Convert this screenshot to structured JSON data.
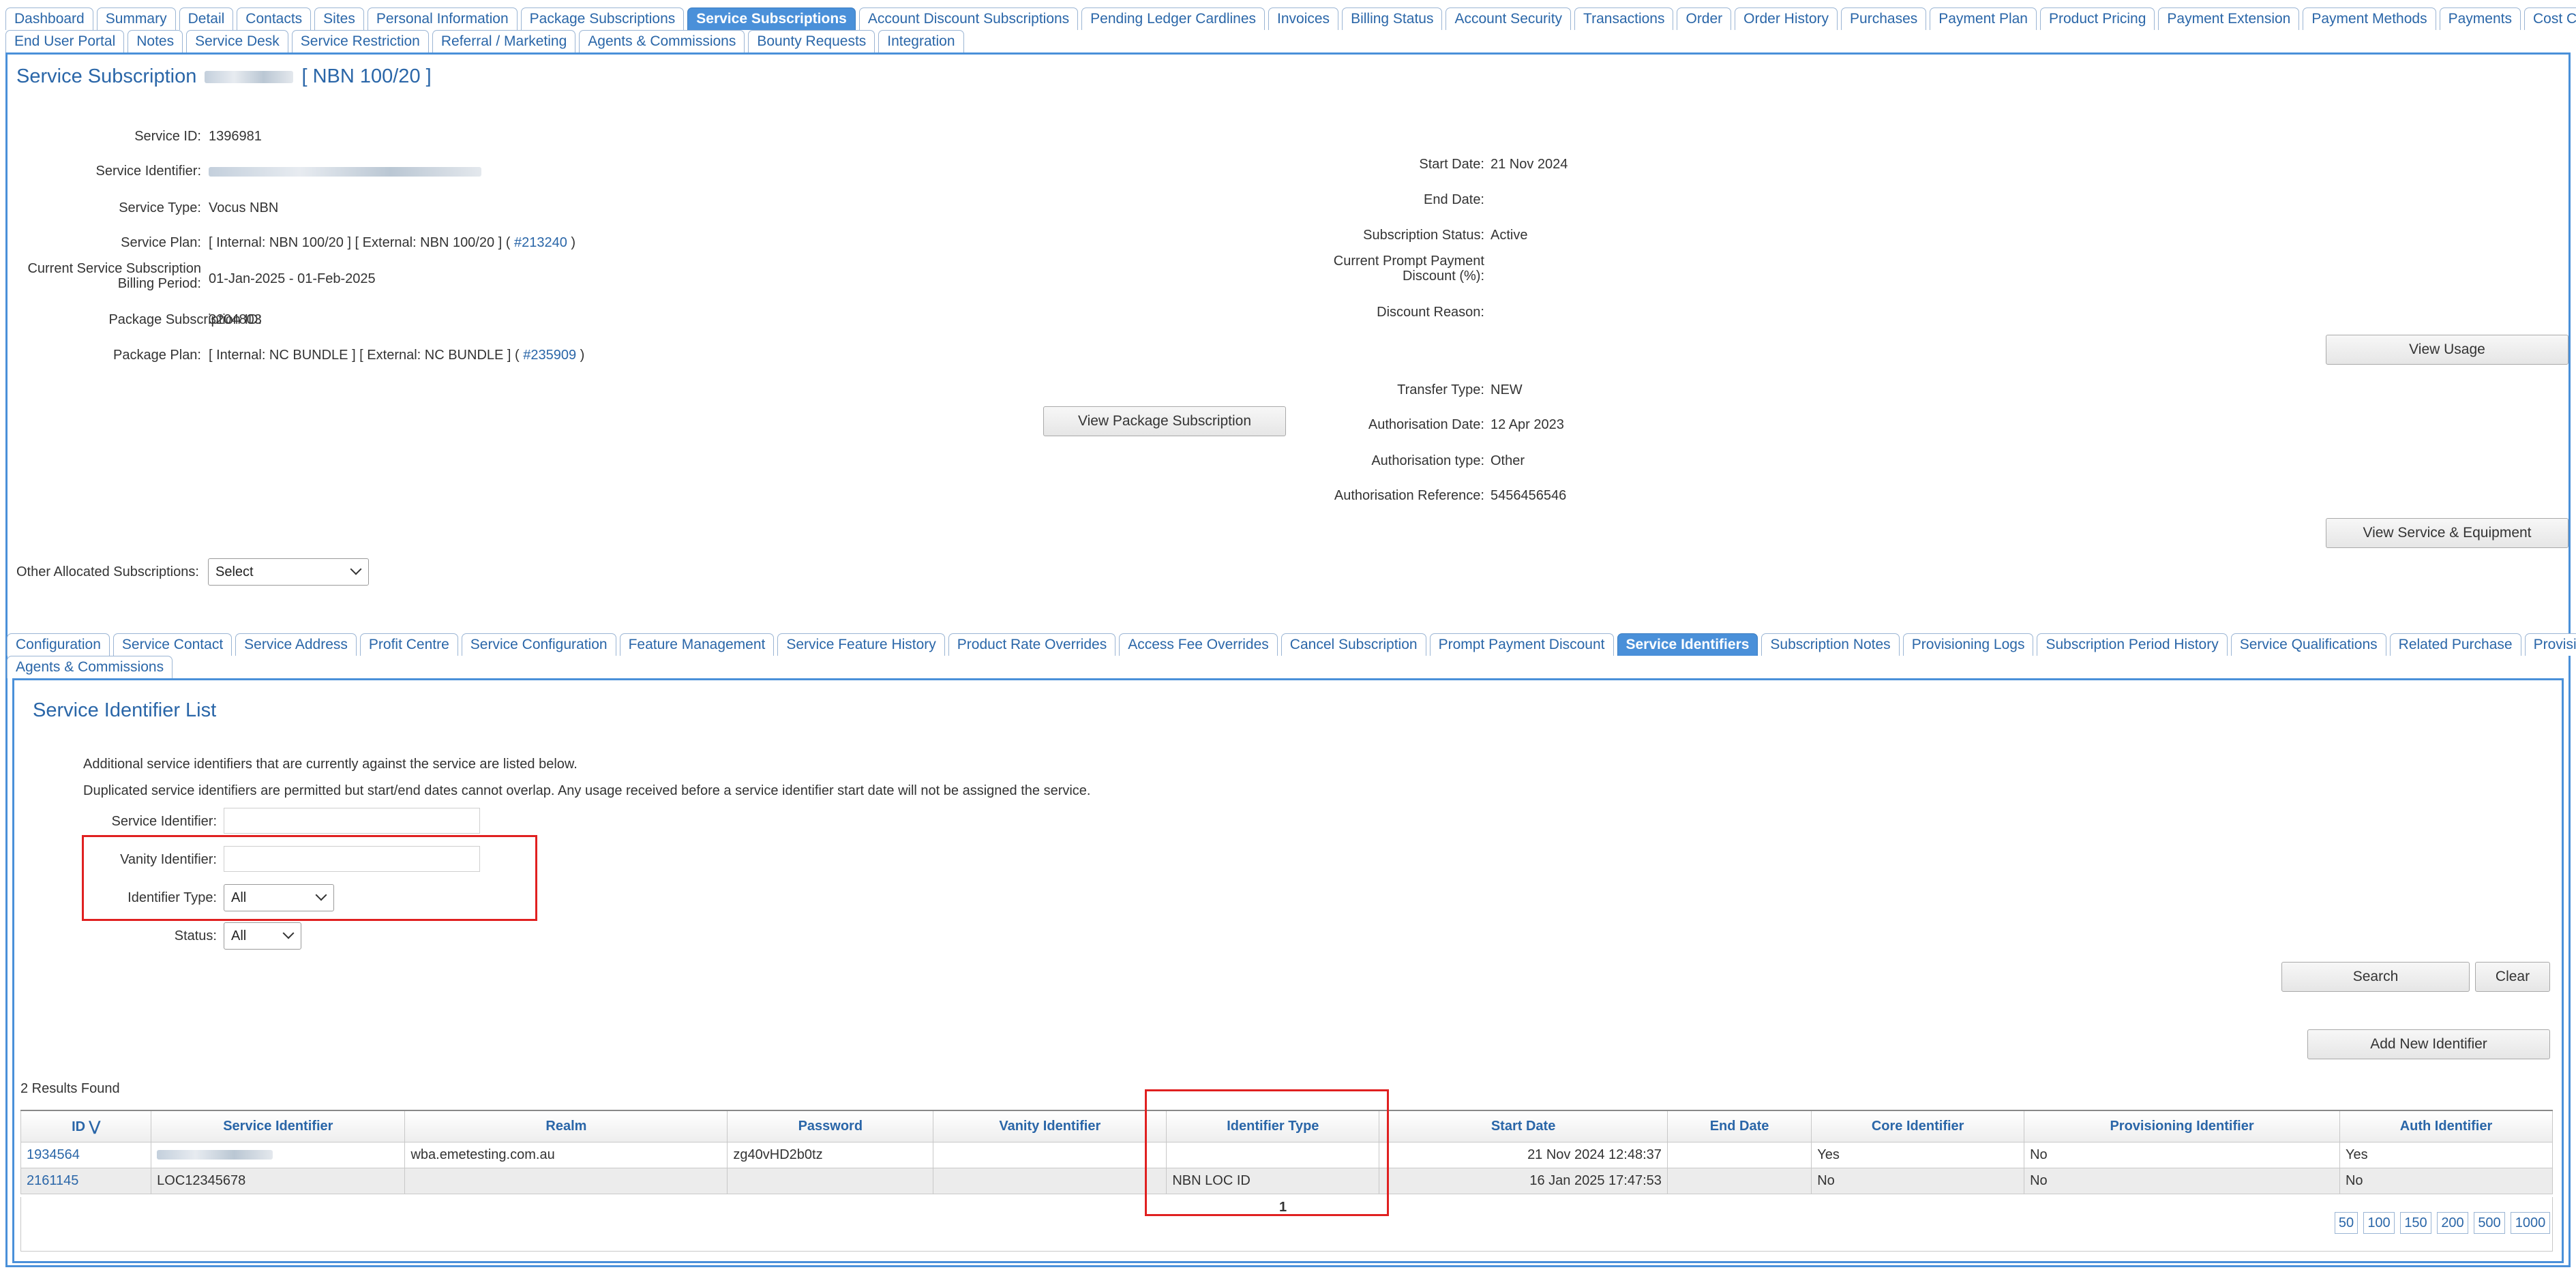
{
  "top_tabs_row1": [
    "Dashboard",
    "Summary",
    "Detail",
    "Contacts",
    "Sites",
    "Personal Information",
    "Package Subscriptions",
    "Service Subscriptions",
    "Account Discount Subscriptions",
    "Pending Ledger Cardlines",
    "Invoices",
    "Billing Status",
    "Account Security",
    "Transactions",
    "Order",
    "Order History",
    "Purchases",
    "Payment Plan",
    "Product Pricing",
    "Payment Extension",
    "Payment Methods",
    "Payments",
    "Cost Centre"
  ],
  "top_tabs_row2": [
    "End User Portal",
    "Notes",
    "Service Desk",
    "Service Restriction",
    "Referral / Marketing",
    "Agents & Commissions",
    "Bounty Requests",
    "Integration"
  ],
  "header": {
    "title_prefix": "Service Subscription",
    "title_suffix": "[ NBN 100/20 ]"
  },
  "details_left": {
    "service_id_label": "Service ID:",
    "service_id": "1396981",
    "service_identifier_label": "Service Identifier:",
    "service_type_label": "Service Type:",
    "service_type": "Vocus NBN",
    "service_plan_label": "Service Plan:",
    "service_plan": "[ Internal: NBN 100/20 ] [ External: NBN 100/20 ]  ( ",
    "service_plan_link": "#213240",
    "service_plan_close": " )",
    "billing_period_label_1": "Current Service Subscription",
    "billing_period_label_2": "Billing Period:",
    "billing_period": "01-Jan-2025 - 01-Feb-2025",
    "package_sub_id_label": "Package Subscription ID:",
    "package_sub_id": "3204803",
    "package_plan_label": "Package Plan:",
    "package_plan": "[ Internal: NC BUNDLE ] [ External: NC BUNDLE ]  ( ",
    "package_plan_link": "#235909",
    "package_plan_close": " )"
  },
  "details_right": {
    "start_date_label": "Start Date:",
    "start_date": "21 Nov 2024",
    "end_date_label": "End Date:",
    "status_label": "Subscription Status:",
    "status": "Active",
    "prompt_label_1": "Current Prompt Payment",
    "prompt_label_2": "Discount (%):",
    "discount_reason_label": "Discount Reason:",
    "transfer_type_label": "Transfer Type:",
    "transfer_type": "NEW",
    "auth_date_label": "Authorisation Date:",
    "auth_date": "12 Apr 2023",
    "auth_type_label": "Authorisation type:",
    "auth_type": "Other",
    "auth_ref_label": "Authorisation Reference:",
    "auth_ref": "5456456546"
  },
  "buttons": {
    "view_usage": "View Usage",
    "view_package": "View Package Subscription",
    "view_service_equipment": "View Service & Equipment",
    "search": "Search",
    "clear": "Clear",
    "add_new": "Add New Identifier"
  },
  "other_allocated": {
    "label": "Other Allocated Subscriptions:",
    "value": "Select"
  },
  "sub_tabs_row1": [
    "Configuration",
    "Service Contact",
    "Service Address",
    "Profit Centre",
    "Service Configuration",
    "Feature Management",
    "Service Feature History",
    "Product Rate Overrides",
    "Access Fee Overrides",
    "Cancel Subscription",
    "Prompt Payment Discount",
    "Service Identifiers",
    "Subscription Notes",
    "Provisioning Logs",
    "Subscription Period History",
    "Service Qualifications",
    "Related Purchase",
    "Provisioning Properties"
  ],
  "sub_tabs_row2": [
    "Agents & Commissions"
  ],
  "identifier_list": {
    "title": "Service Identifier List",
    "info1": "Additional service identifiers that are currently against the service are listed below.",
    "info2": "Duplicated service identifiers are permitted but start/end dates cannot overlap. Any usage received before a service identifier start date will not be assigned the service.",
    "service_identifier_label": "Service Identifier:",
    "vanity_label": "Vanity Identifier:",
    "identifier_type_label": "Identifier Type:",
    "identifier_type_value": "All",
    "status_label": "Status:",
    "status_value": "All",
    "results": "2 Results Found"
  },
  "table": {
    "headers": [
      "ID",
      "Service Identifier",
      "Realm",
      "Password",
      "Vanity Identifier",
      "Identifier Type",
      "Start Date",
      "End Date",
      "Core Identifier",
      "Provisioning Identifier",
      "Auth Identifier"
    ],
    "rows": [
      [
        "1934564",
        "",
        "wba.emetesting.com.au",
        "zg40vHD2b0tz",
        "",
        "",
        "21 Nov 2024 12:48:37",
        "",
        "Yes",
        "No",
        "Yes"
      ],
      [
        "2161145",
        "LOC12345678",
        "",
        "",
        "",
        "NBN LOC ID",
        "16 Jan 2025 17:47:53",
        "",
        "No",
        "No",
        "No"
      ]
    ],
    "page_number": "1",
    "page_sizes": [
      "50",
      "100",
      "150",
      "200",
      "500",
      "1000"
    ]
  },
  "colors": {
    "accent": "#4a90d9",
    "link": "#2a66a8",
    "highlight": "#e02020"
  }
}
